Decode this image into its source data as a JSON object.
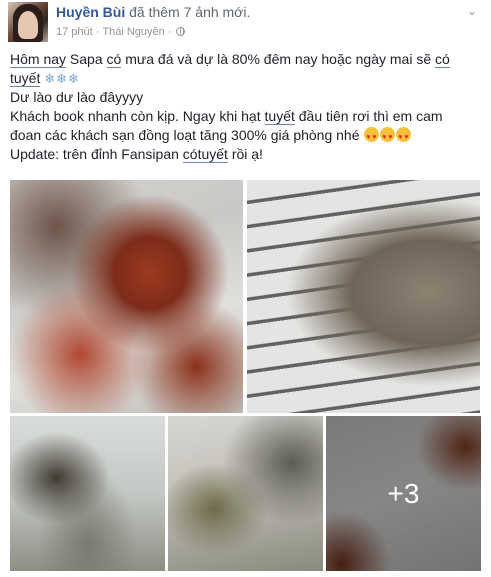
{
  "post": {
    "author": "Huyền Bùi",
    "action": "đã thêm 7 ảnh mới.",
    "time": "17 phút",
    "location": "Thái Nguyên",
    "privacy_icon": "globe-icon",
    "menu_icon": "chevron-down-icon"
  },
  "text": {
    "line1": {
      "t1": "Hôm nay",
      "t2": " Sapa ",
      "t3": "có",
      "t4": " mưa đá và dự là 80% đêm nay hoặc ngày mai sẽ ",
      "t5": "có"
    },
    "line2": {
      "t1": "tuyết",
      "snow": "❄❄❄"
    },
    "line3": "Dư lào dư lào đâyyyy",
    "line4": {
      "t1": "Khách book nhanh còn kịp. Ngay khi hạt ",
      "t2": "tuyết",
      "t3": " đầu tiên rơi thì em cam"
    },
    "line5": "đoan các khách sạn đồng loạt tăng 300% giá phòng nhé",
    "line6": {
      "t1": "Update: trên đỉnh Fansipan ",
      "t2": "có",
      "t3": "tuyết",
      "t4": " rồi ạ!"
    }
  },
  "photos": {
    "more_count": "+3"
  },
  "colors": {
    "link": "#365899",
    "meta": "#90949c",
    "text": "#1d2129"
  }
}
